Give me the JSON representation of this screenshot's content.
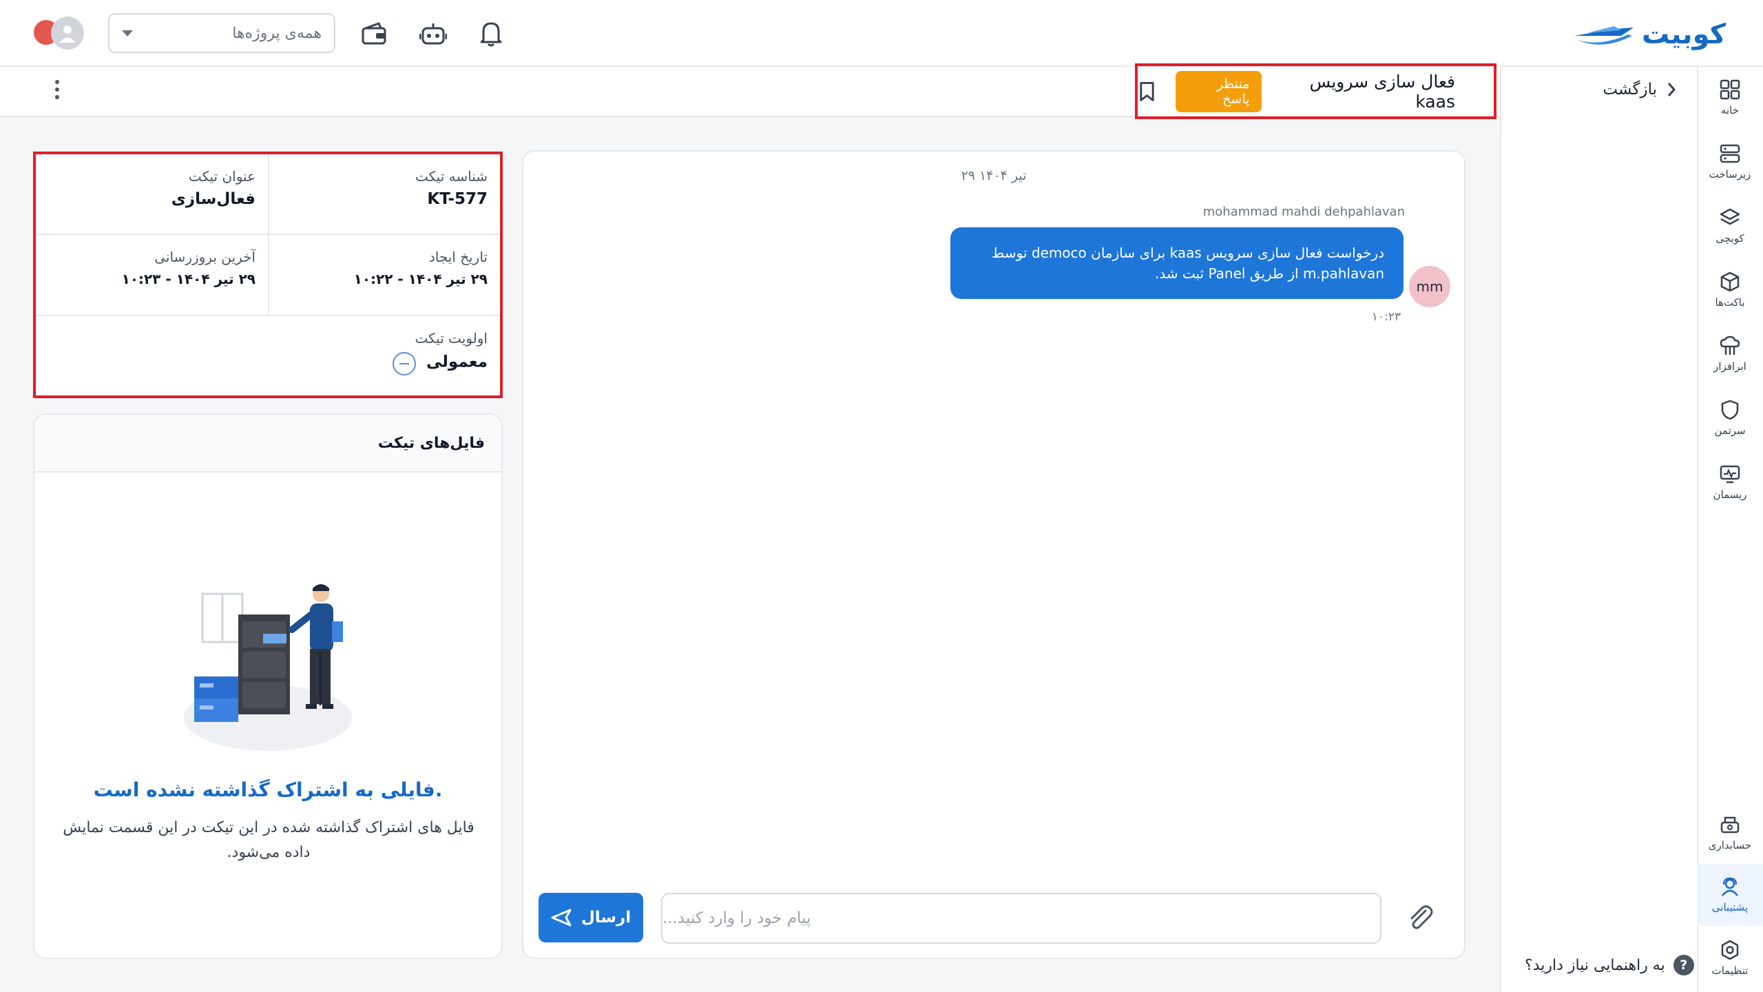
{
  "brand": {
    "name": "کوبیت",
    "color": "#1569c7"
  },
  "topbar": {
    "project_select_placeholder": "همه‌ی پروژه‌ها",
    "icons": [
      "bell-icon",
      "robot-icon",
      "wallet-icon",
      "avatar"
    ]
  },
  "sidenav": {
    "items": [
      {
        "label": "خانه",
        "icon": "grid-icon"
      },
      {
        "label": "زیرساخت",
        "icon": "server-icon"
      },
      {
        "label": "کوبچی",
        "icon": "layers-icon"
      },
      {
        "label": "باکت‌ها",
        "icon": "box-icon"
      },
      {
        "label": "ابرافزار",
        "icon": "cloud-app-icon"
      },
      {
        "label": "سرتمن",
        "icon": "shield-icon"
      },
      {
        "label": "ریسمان",
        "icon": "monitor-icon"
      }
    ],
    "bottom_items": [
      {
        "label": "حسابداری",
        "icon": "accounting-icon"
      },
      {
        "label": "پشتیبانی",
        "icon": "support-icon",
        "active": true
      },
      {
        "label": "تنظیمات",
        "icon": "settings-icon"
      }
    ]
  },
  "subpanel": {
    "back_label": "بازگشت",
    "help_label": "به راهنمایی نیاز دارید؟"
  },
  "ticket": {
    "title": "فعال سازی سرویس kaas",
    "status": "منتظر پاسخ",
    "status_color": "#f59e0b"
  },
  "chat": {
    "date": "۲۹ تیر ۱۴۰۴",
    "messages": [
      {
        "sender": "mohammad mahdi dehpahlavan",
        "avatar_initials": "mm",
        "text": "درخواست فعال سازی سرویس kaas برای سازمان democo توسط m.pahlavan از طریق Panel ثبت شد.",
        "time": "۱۰:۲۳"
      }
    ],
    "composer_placeholder": "پیام خود را وارد کنید...",
    "send_label": "ارسال"
  },
  "info": {
    "id_label": "شناسه تیکت",
    "id_value": "KT-577",
    "subject_label": "عنوان تیکت",
    "subject_value": "فعال‌سازی",
    "created_label": "تاریخ ایجاد",
    "created_value": "۲۹ تیر ۱۴۰۴ - ۱۰:۲۲",
    "updated_label": "آخرین بروزرسانی",
    "updated_value": "۲۹ تیر ۱۴۰۴ - ۱۰:۲۳",
    "priority_label": "اولویت تیکت",
    "priority_value": "معمولی"
  },
  "files": {
    "title": "فایل‌های تیکت",
    "empty_title": "فایلی به اشتراک گذاشته نشده است.",
    "empty_desc": "فایل های اشتراک گذاشته شده در این تیکت در این قسمت نمایش داده می‌شود."
  }
}
